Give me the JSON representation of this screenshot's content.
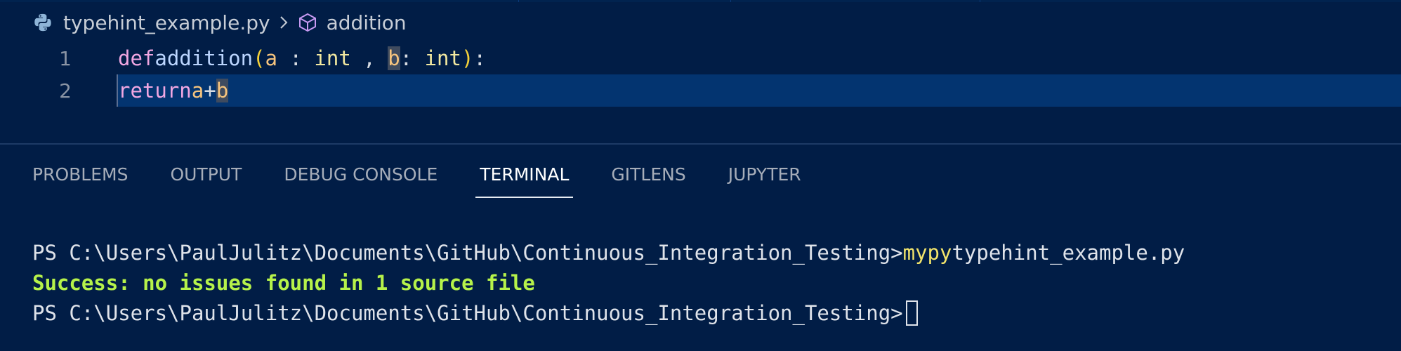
{
  "breadcrumb": {
    "file_icon": "python-file-icon",
    "file_name": "typehint_example.py",
    "separator_icon": "chevron-right-icon",
    "symbol_icon": "method-cube-icon",
    "symbol_name": "addition"
  },
  "editor": {
    "lines": [
      {
        "number": "1",
        "tokens": {
          "def": "def",
          "name": "addition",
          "open_paren": "(",
          "param_a": "a",
          "colon1": " : ",
          "type1": "int",
          "comma": " , ",
          "param_b": "b",
          "colon2": ": ",
          "type2": "int",
          "close_paren": ")",
          "colon_end": ":"
        }
      },
      {
        "number": "2",
        "tokens": {
          "return": "return",
          "a": "a",
          "plus": "+",
          "b": "b"
        }
      }
    ]
  },
  "panel": {
    "tabs": [
      "PROBLEMS",
      "OUTPUT",
      "DEBUG CONSOLE",
      "TERMINAL",
      "GITLENS",
      "JUPYTER"
    ],
    "active_tab": "TERMINAL"
  },
  "terminal": {
    "prompt1": "PS C:\\Users\\PaulJulitz\\Documents\\GitHub\\Continuous_Integration_Testing>",
    "command": "mypy",
    "command_arg": "typehint_example.py",
    "success_message": "Success: no issues found in 1 source file",
    "prompt2": "PS C:\\Users\\PaulJulitz\\Documents\\GitHub\\Continuous_Integration_Testing>"
  },
  "colors": {
    "background": "#011d46",
    "current_line": "#033470",
    "keyword": "#f1a7e2",
    "function": "#bcd6ff",
    "bracket": "#f4d13a",
    "parameter": "#f6c47e",
    "success": "#b6f24a",
    "command": "#f2e46b"
  }
}
